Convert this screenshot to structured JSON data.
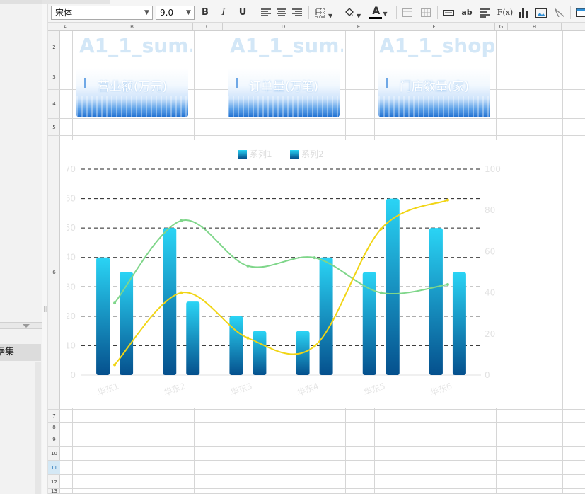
{
  "toolbar": {
    "font_name": "宋体",
    "font_size": "9.0",
    "bold": "B",
    "italic": "I",
    "underline": "U",
    "ab_label": "ab",
    "formula_label": "F(x)",
    "text_color": "#000000",
    "fill_color": "#ffffff"
  },
  "sheet": {
    "col_labels": [
      "A",
      "B",
      "C",
      "D",
      "E",
      "F",
      "G",
      "H"
    ],
    "row_labels": [
      "2",
      "3",
      "4",
      "5",
      "6",
      "7",
      "8",
      "9",
      "10",
      "11",
      "12",
      "13"
    ],
    "selected_row": "11"
  },
  "kpis": [
    {
      "title": "A1_1_sum.",
      "label": "营业额(万元)"
    },
    {
      "title": "A1_1_sum.",
      "label": "订单量(万笔)"
    },
    {
      "title": "A1_1_shop.",
      "label": "门店数量(家)"
    }
  ],
  "left_panel": {
    "dataset_tab": "据集"
  },
  "chart_data": {
    "type": "bar",
    "categories": [
      "华东1",
      "华东2",
      "华东3",
      "华东4",
      "华东5",
      "华东6"
    ],
    "series": [
      {
        "name": "系列1",
        "kind": "bar",
        "values": [
          40,
          50,
          20,
          15,
          35,
          50
        ]
      },
      {
        "name": "系列2",
        "kind": "bar",
        "values": [
          35,
          25,
          15,
          40,
          60,
          35
        ]
      },
      {
        "name": "",
        "kind": "line",
        "axis": "right",
        "values": [
          35,
          75,
          53,
          57,
          40,
          44
        ],
        "color": "#7fd68a"
      },
      {
        "name": "",
        "kind": "line",
        "axis": "right",
        "values": [
          5,
          40,
          18,
          14,
          71,
          85
        ],
        "color": "#f1d515"
      }
    ],
    "left_axis": {
      "ticks": [
        "0",
        "10",
        "20",
        "30",
        "40",
        "50",
        "60",
        "70"
      ],
      "ylim": [
        0,
        70
      ]
    },
    "right_axis": {
      "ticks": [
        "0",
        "20",
        "40",
        "60",
        "80",
        "100"
      ],
      "ylim": [
        0,
        100
      ]
    },
    "legend": {
      "items": [
        "系列1",
        "系列2"
      ],
      "position": "top-center"
    },
    "grid": "dashed horizontal",
    "colors": {
      "bar_top": "#2ad4f5",
      "bar_bottom": "#05508d",
      "line_green": "#7fd68a",
      "line_yellow": "#f1d515"
    }
  }
}
